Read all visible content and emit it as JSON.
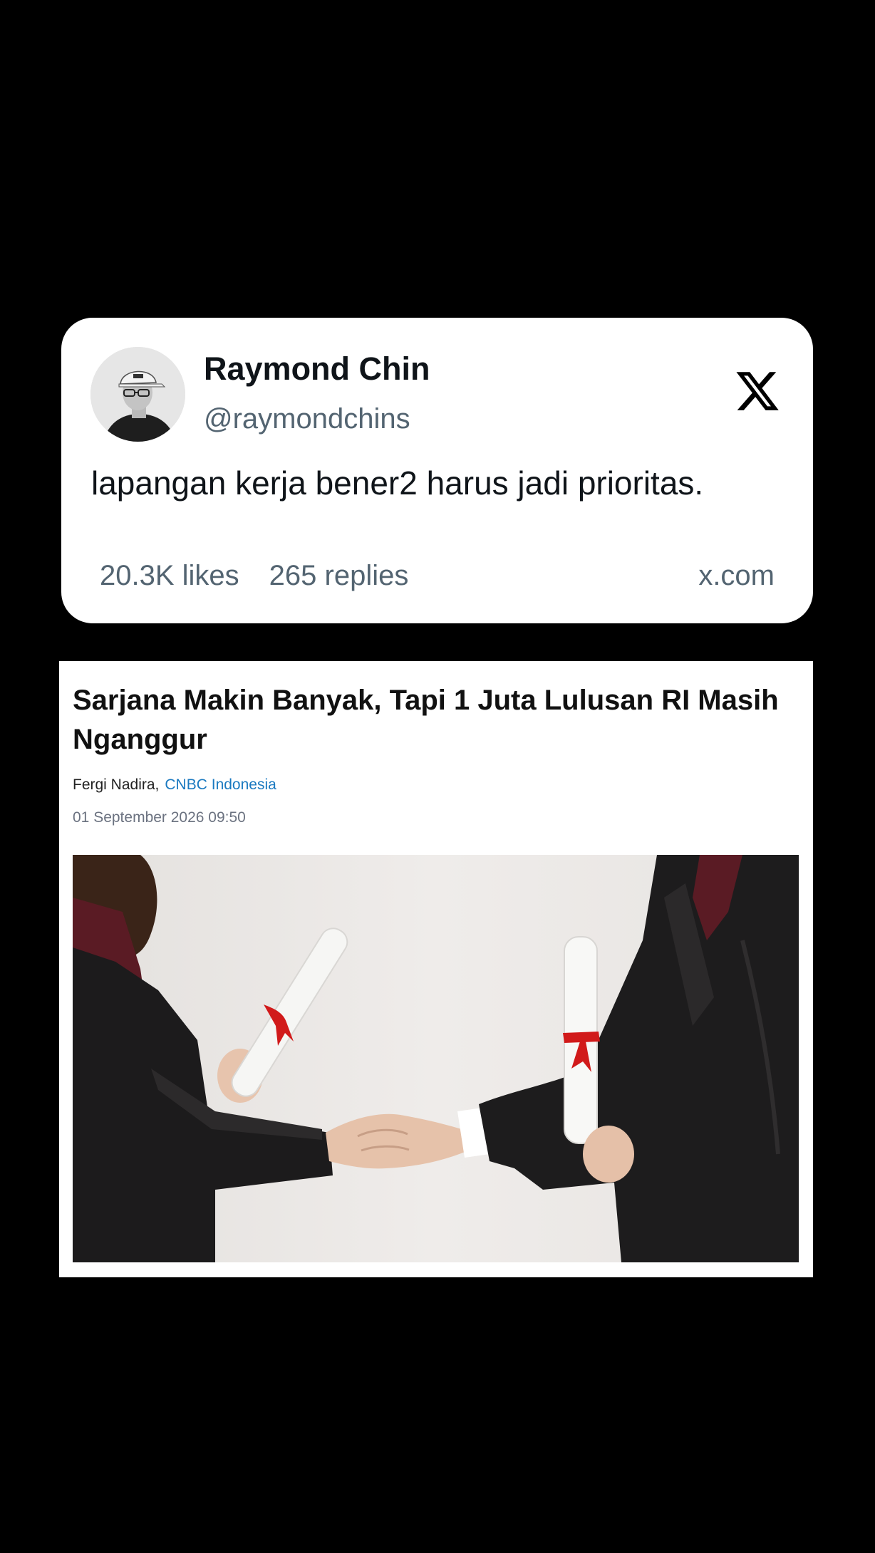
{
  "tweet": {
    "author_name": "Raymond Chin",
    "handle": "@raymondchins",
    "text": "lapangan kerja bener2 harus jadi prioritas.",
    "likes": "20.3K likes",
    "replies": "265 replies",
    "domain": "x.com",
    "logo_icon": "x-logo-icon"
  },
  "article": {
    "headline": "Sarjana Makin Banyak, Tapi 1 Juta Lulusan RI Masih Nganggur",
    "author": "Fergi Nadira,",
    "source": "CNBC Indonesia",
    "date": "01 September 2026 09:50",
    "source_color": "#1a79c0"
  }
}
